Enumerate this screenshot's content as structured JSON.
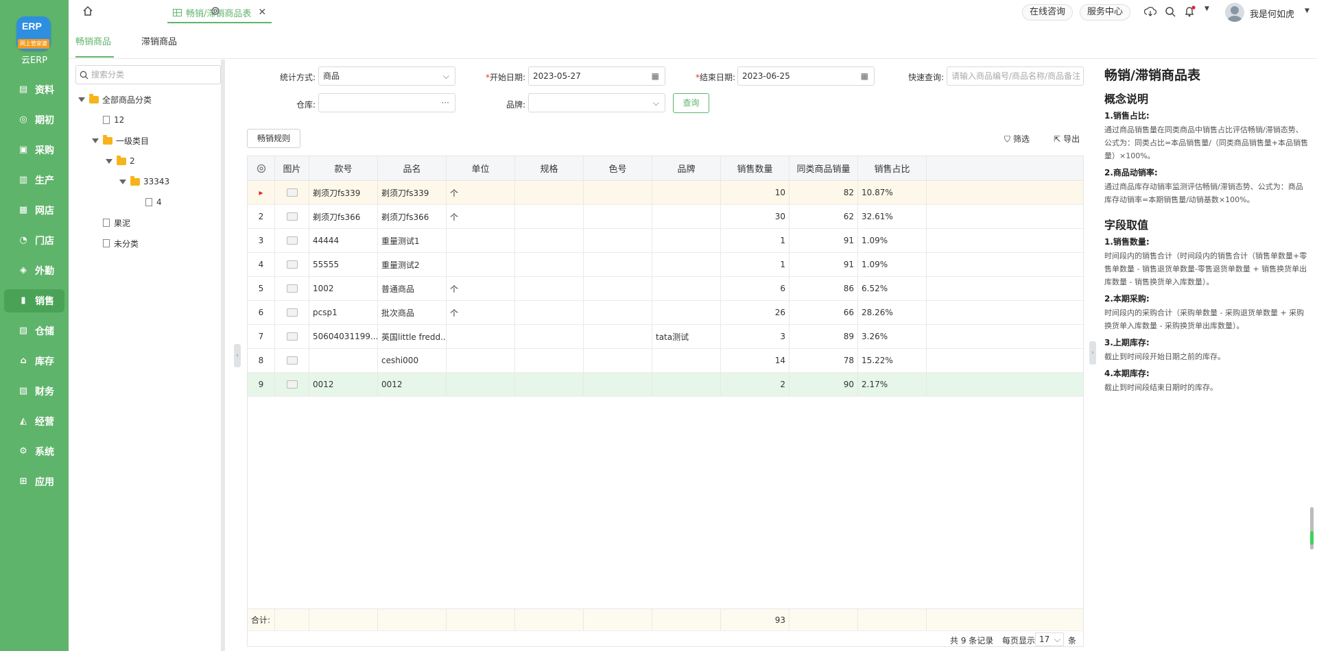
{
  "app": {
    "logo_text": "ERP",
    "logo_ribbon": "网上管家婆",
    "product_name": "云ERP",
    "accent": "#5fb46b"
  },
  "nav": [
    {
      "label": "资料",
      "icon": "doc-icon"
    },
    {
      "label": "期初",
      "icon": "target-icon"
    },
    {
      "label": "采购",
      "icon": "cart-icon"
    },
    {
      "label": "生产",
      "icon": "factory-icon"
    },
    {
      "label": "网店",
      "icon": "shop-icon"
    },
    {
      "label": "门店",
      "icon": "pie-icon"
    },
    {
      "label": "外勤",
      "icon": "compass-icon"
    },
    {
      "label": "销售",
      "icon": "chart-icon"
    },
    {
      "label": "仓储",
      "icon": "box-icon"
    },
    {
      "label": "库存",
      "icon": "house-icon"
    },
    {
      "label": "财务",
      "icon": "wallet-icon"
    },
    {
      "label": "经营",
      "icon": "trend-icon"
    },
    {
      "label": "系统",
      "icon": "gear-icon"
    },
    {
      "label": "应用",
      "icon": "plus-icon"
    }
  ],
  "topbar": {
    "tab_title": "畅销/滞销商品表",
    "consult": "在线咨询",
    "service": "服务中心",
    "user": "我是何如虎"
  },
  "subtabs": [
    "畅销商品",
    "滞销商品"
  ],
  "tree": {
    "search_placeholder": "搜索分类",
    "nodes": [
      "全部商品分类",
      "12",
      "一级类目",
      "2",
      "33343",
      "4",
      "果泥",
      "未分类"
    ]
  },
  "filters": {
    "stat_label": "统计方式:",
    "stat_value": "商品",
    "start_label": "开始日期:",
    "start_value": "2023-05-27",
    "end_label": "结束日期:",
    "end_value": "2023-06-25",
    "quick_label": "快速查询:",
    "quick_placeholder": "请输入商品编号/商品名称/商品备注",
    "warehouse_label": "仓库:",
    "warehouse_suffix": "···",
    "brand_label": "品牌:",
    "query": "查询"
  },
  "toolbar": {
    "rule": "畅销规则",
    "filter": "筛选",
    "export": "导出"
  },
  "table": {
    "headers": [
      "图片",
      "款号",
      "品名",
      "单位",
      "规格",
      "色号",
      "品牌",
      "销售数量",
      "同类商品销量",
      "销售占比"
    ],
    "rows": [
      {
        "idx": "▸",
        "code": "剃须刀fs339",
        "name": "剃须刀fs339",
        "unit": "个",
        "spec": "",
        "color": "",
        "brand": "",
        "qty": "10",
        "same": "82",
        "ratio": "10.87%"
      },
      {
        "idx": "2",
        "code": "剃须刀fs366",
        "name": "剃须刀fs366",
        "unit": "个",
        "spec": "",
        "color": "",
        "brand": "",
        "qty": "30",
        "same": "62",
        "ratio": "32.61%"
      },
      {
        "idx": "3",
        "code": "44444",
        "name": "重量测试1",
        "unit": "",
        "spec": "",
        "color": "",
        "brand": "",
        "qty": "1",
        "same": "91",
        "ratio": "1.09%"
      },
      {
        "idx": "4",
        "code": "55555",
        "name": "重量测试2",
        "unit": "",
        "spec": "",
        "color": "",
        "brand": "",
        "qty": "1",
        "same": "91",
        "ratio": "1.09%"
      },
      {
        "idx": "5",
        "code": "1002",
        "name": "普通商品",
        "unit": "个",
        "spec": "",
        "color": "",
        "brand": "",
        "qty": "6",
        "same": "86",
        "ratio": "6.52%"
      },
      {
        "idx": "6",
        "code": "pcsp1",
        "name": "批次商品",
        "unit": "个",
        "spec": "",
        "color": "",
        "brand": "",
        "qty": "26",
        "same": "66",
        "ratio": "28.26%"
      },
      {
        "idx": "7",
        "code": "50604031199...",
        "name": "英国little fredd...",
        "unit": "",
        "spec": "",
        "color": "",
        "brand": "tata测试",
        "qty": "3",
        "same": "89",
        "ratio": "3.26%"
      },
      {
        "idx": "8",
        "code": "",
        "name": "ceshi000",
        "unit": "",
        "spec": "",
        "color": "",
        "brand": "",
        "qty": "14",
        "same": "78",
        "ratio": "15.22%"
      },
      {
        "idx": "9",
        "code": "0012",
        "name": "0012",
        "unit": "",
        "spec": "",
        "color": "",
        "brand": "",
        "qty": "2",
        "same": "90",
        "ratio": "2.17%"
      }
    ],
    "sum_label": "合计:",
    "sum_qty": "93"
  },
  "pager": {
    "total": "共 9 条记录",
    "per_page_label": "每页显示",
    "per_page": "17",
    "unit": "条"
  },
  "help": {
    "title": "畅销/滞销商品表",
    "s1": "概念说明",
    "h1": "1.销售占比:",
    "p1": "通过商品销售量在同类商品中销售占比评估畅销/滞销态势、公式为：同类占比=本品销售量/（同类商品销售量+本品销售量）×100%。",
    "h2": "2.商品动销率:",
    "p2": "通过商品库存动销率监测评估畅销/滞销态势、公式为：商品库存动销率=本期销售量/动销基数×100%。",
    "s2": "字段取值",
    "h3": "1.销售数量:",
    "p3": "时间段内的销售合计（时间段内的销售合计（销售单数量+零售单数量 - 销售退货单数量-零售退货单数量 + 销售换货单出库数量 - 销售换货单入库数量）。",
    "h4": "2.本期采购:",
    "p4": "时间段内的采购合计（采购单数量 - 采购退货单数量 + 采购换货单入库数量 - 采购换货单出库数量）。",
    "h5": "3.上期库存:",
    "p5": "截止到时间段开始日期之前的库存。",
    "h6": "4.本期库存:",
    "p6": "截止到时间段结束日期时的库存。"
  }
}
